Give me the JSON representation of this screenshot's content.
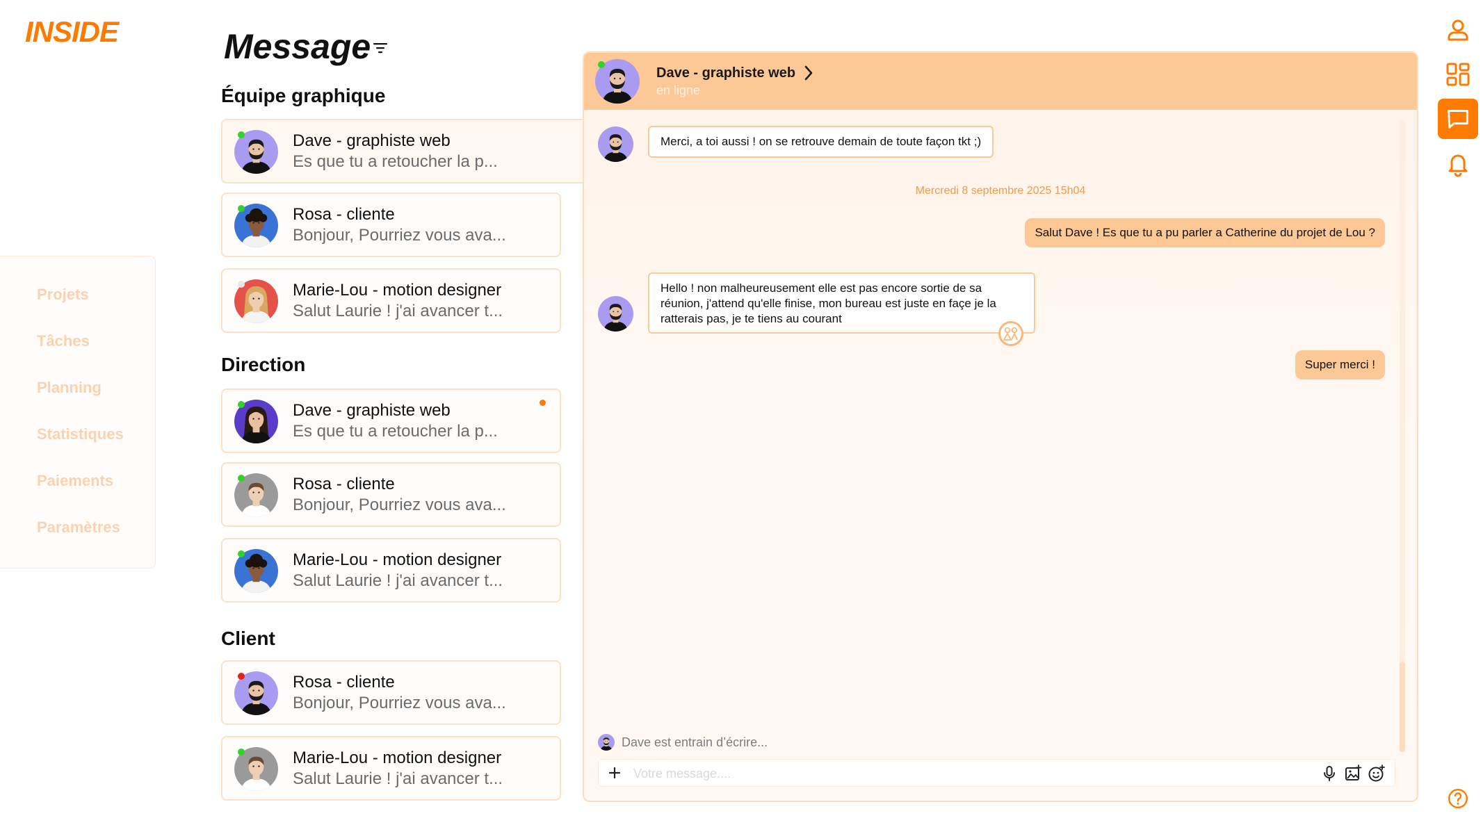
{
  "brand": {
    "logo": "INSIDE",
    "accent": "#ff7a00"
  },
  "nav": {
    "items": [
      {
        "label": "Projets"
      },
      {
        "label": "Tâches"
      },
      {
        "label": "Planning"
      },
      {
        "label": "Statistiques"
      },
      {
        "label": "Paiements"
      },
      {
        "label": "Paramètres"
      }
    ]
  },
  "page": {
    "title": "Message",
    "filter_icon": "filter-icon"
  },
  "groups": [
    {
      "title": "Équipe graphique",
      "contacts": [
        {
          "name": "Dave - graphiste web",
          "preview": "Es que tu a retoucher la p...",
          "status": "online",
          "active": true
        },
        {
          "name": "Rosa - cliente",
          "preview": "Bonjour, Pourriez vous ava...",
          "status": "online"
        },
        {
          "name": "Marie-Lou - motion designer",
          "preview": "Salut Laurie ! j'ai avancer t...",
          "status": "offline"
        }
      ]
    },
    {
      "title": "Direction",
      "contacts": [
        {
          "name": "Dave - graphiste web",
          "preview": "Es que tu a retoucher la p...",
          "status": "online",
          "unread": true
        },
        {
          "name": "Rosa - cliente",
          "preview": "Bonjour, Pourriez vous ava...",
          "status": "online"
        },
        {
          "name": "Marie-Lou - motion designer",
          "preview": "Salut Laurie ! j'ai avancer t...",
          "status": "online"
        }
      ]
    },
    {
      "title": "Client",
      "contacts": [
        {
          "name": "Rosa - cliente",
          "preview": "Bonjour, Pourriez vous ava...",
          "status": "busy"
        },
        {
          "name": "Marie-Lou - motion designer",
          "preview": "Salut Laurie ! j'ai avancer t...",
          "status": "online"
        }
      ]
    }
  ],
  "chat": {
    "contact_name": "Dave - graphiste web",
    "contact_status": "en ligne",
    "messages": [
      {
        "from": "in",
        "text": "Merci, a toi aussi ! on se retrouve demain de toute façon tkt ;)"
      },
      {
        "from": "out",
        "text": "Salut Dave ! Es que tu a pu parler a Catherine du projet de Lou ?"
      },
      {
        "from": "in",
        "text": "Hello ! non malheureusement elle est pas encore sortie de sa réunion, j'attend qu'elle finise, mon bureau est juste en façe je la ratterais pas, je te tiens au courant"
      },
      {
        "from": "out",
        "text": "Super merci !"
      }
    ],
    "date_separator": "Mercredi 8 septembre 2025 15h04",
    "typing": "Dave est entrain d’écrire...",
    "composer": {
      "placeholder": "Votre message...."
    }
  },
  "right_bar": {
    "icons": [
      "user-icon",
      "dashboard-icon",
      "message-icon",
      "bell-icon",
      "help-icon"
    ],
    "active": "message-icon"
  },
  "colors": {
    "header_bg": "#fcc896",
    "online": "#33d12b",
    "busy": "#e0251b",
    "offline": "#d9d9d9"
  }
}
